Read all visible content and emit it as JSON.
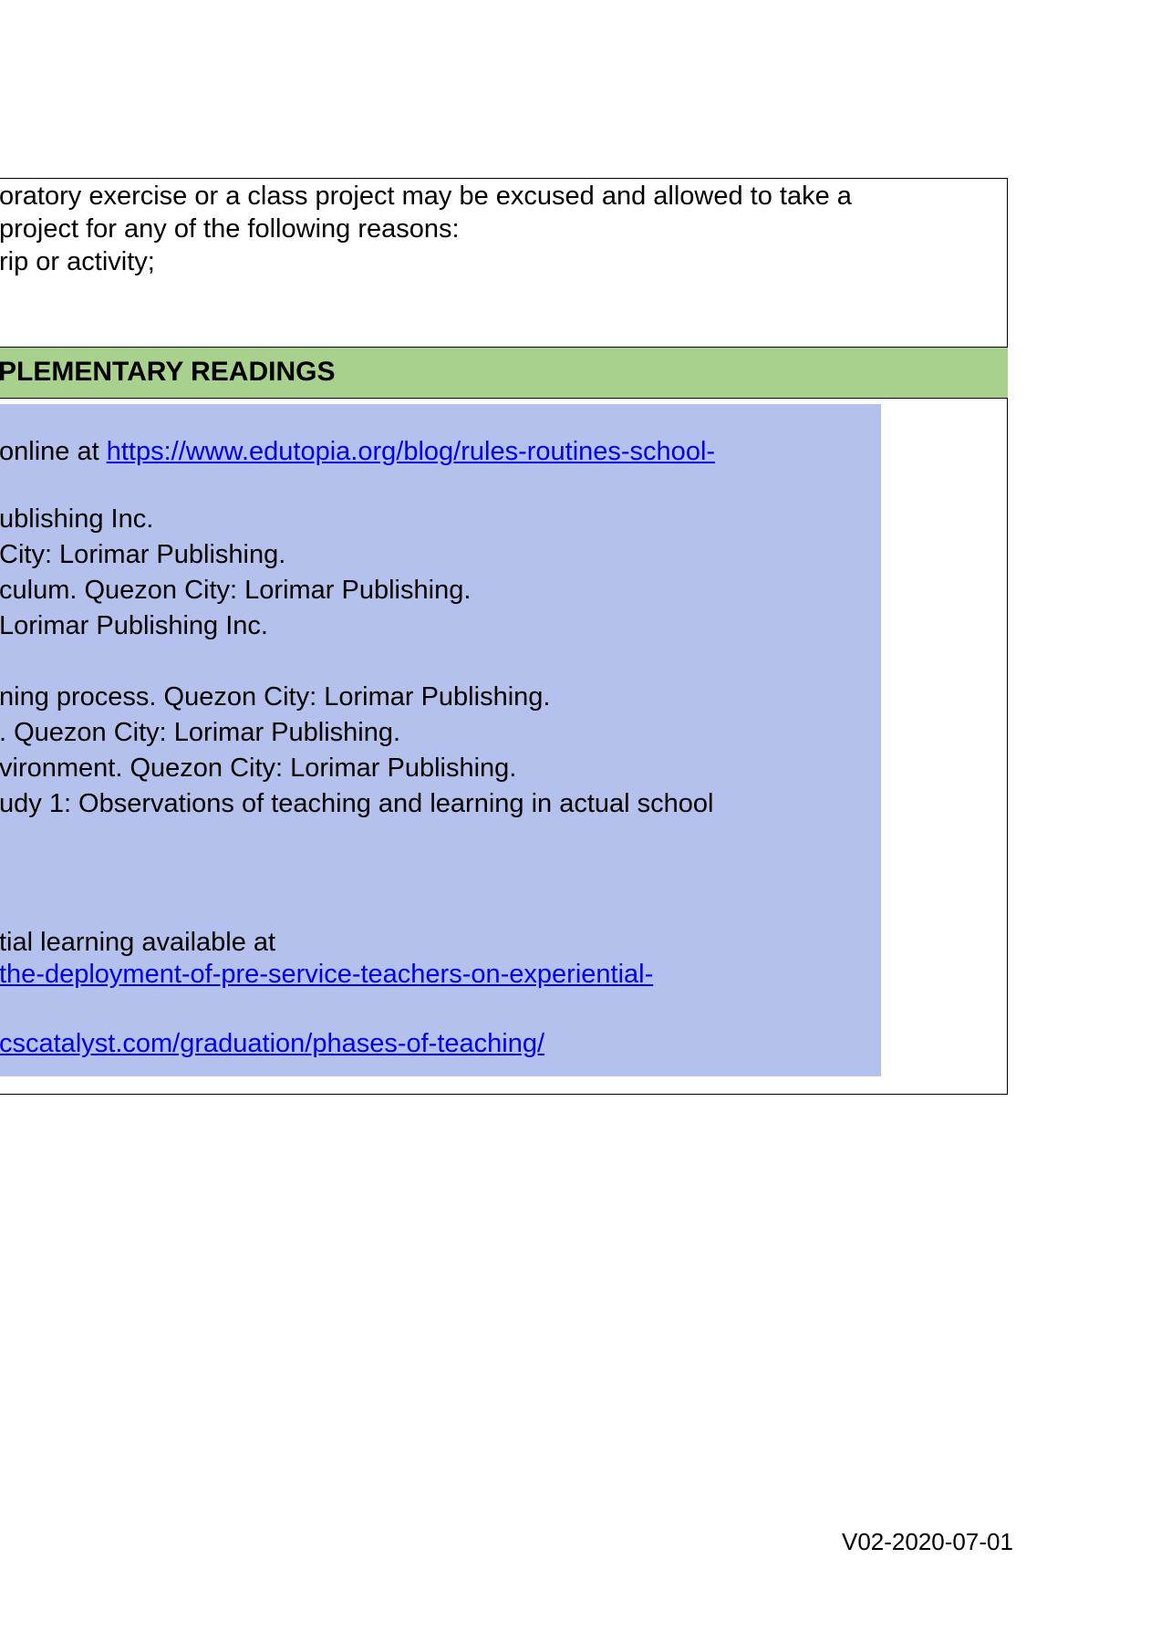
{
  "policy": {
    "lines": [
      "oratory exercise or a class project may be excused and allowed to take a",
      "project for any of the following reasons:",
      "rip or activity;"
    ]
  },
  "readings": {
    "title": "PLEMENTARY READINGS",
    "ref1_prefix": "online at ",
    "ref1_link": "https://www.edutopia.org/blog/rules-routines-school-",
    "ref2": "ublishing Inc.",
    "ref3": "City: Lorimar Publishing.",
    "ref4": "culum. Quezon City: Lorimar Publishing.",
    "ref5": "Lorimar Publishing Inc.",
    "ref6": "ning process. Quezon City: Lorimar Publishing.",
    "ref7": ". Quezon City: Lorimar Publishing.",
    "ref8": "vironment. Quezon City: Lorimar Publishing.",
    "ref9": "udy 1: Observations of teaching and learning in actual school",
    "ref10": "tial learning  available at",
    "ref10_link": "the-deployment-of-pre-service-teachers-on-experiential-",
    "ref11_link": "cscatalyst.com/graduation/phases-of-teaching/"
  },
  "footer": {
    "version": "V02-2020-07-01"
  },
  "colors": {
    "header_bg": "#a9d18e",
    "readings_bg": "#b4c1ed",
    "link": "#0000ee"
  }
}
